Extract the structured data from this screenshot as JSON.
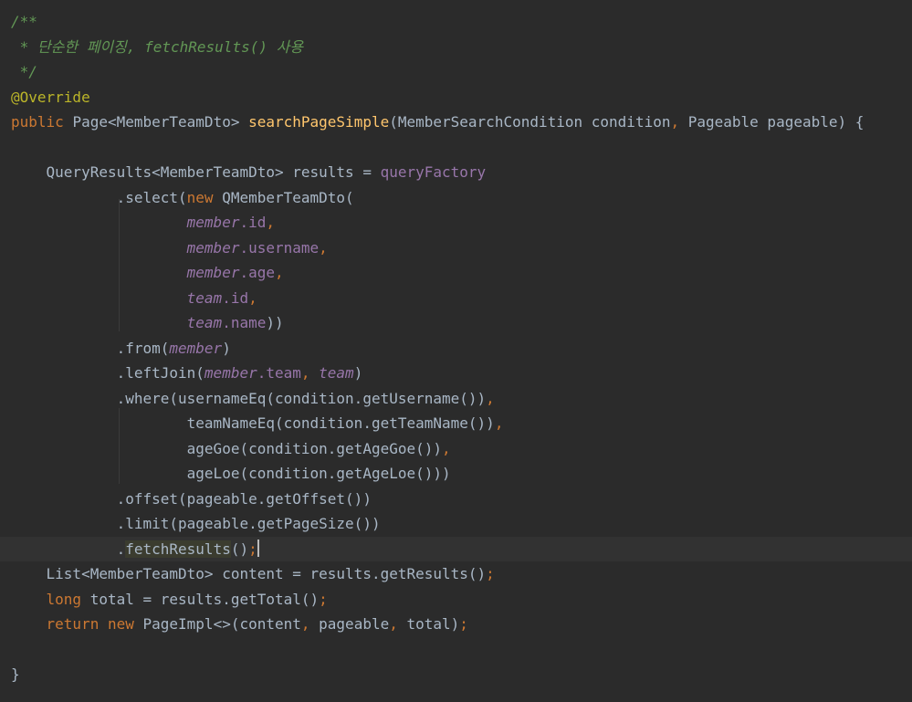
{
  "colors": {
    "background": "#2b2b2b",
    "current_line": "#323232",
    "text": "#a9b7c6",
    "keyword": "#cc7832",
    "annotation": "#bbb529",
    "method_decl": "#ffc66d",
    "field": "#9876aa",
    "doc_comment": "#629755"
  },
  "caret_line": 22,
  "lines": [
    [
      {
        "t": "/**",
        "c": "doc"
      }
    ],
    [
      {
        "t": " * 단순한 페이징, fetchResults() 사용",
        "c": "doc"
      }
    ],
    [
      {
        "t": " */",
        "c": "doc"
      }
    ],
    [
      {
        "t": "@Override",
        "c": "ann"
      }
    ],
    [
      {
        "t": "public ",
        "c": "kw"
      },
      {
        "t": "Page<MemberTeamDto> ",
        "c": "txt"
      },
      {
        "t": "searchPageSimple",
        "c": "fn"
      },
      {
        "t": "(MemberSearchCondition condition",
        "c": "txt"
      },
      {
        "t": ", ",
        "c": "kw"
      },
      {
        "t": "Pageable pageable) {",
        "c": "txt"
      }
    ],
    [],
    [
      {
        "t": "    QueryResults<MemberTeamDto> results = ",
        "c": "txt"
      },
      {
        "t": "queryFactory",
        "c": "field"
      }
    ],
    [
      {
        "t": "            .select(",
        "c": "txt"
      },
      {
        "t": "new ",
        "c": "kw"
      },
      {
        "t": "QMemberTeamDto(",
        "c": "txt"
      }
    ],
    [
      {
        "t": "                    ",
        "c": "txt"
      },
      {
        "t": "member",
        "c": "field-i"
      },
      {
        "t": ".id",
        "c": "field"
      },
      {
        "t": ",",
        "c": "kw"
      }
    ],
    [
      {
        "t": "                    ",
        "c": "txt"
      },
      {
        "t": "member",
        "c": "field-i"
      },
      {
        "t": ".username",
        "c": "field"
      },
      {
        "t": ",",
        "c": "kw"
      }
    ],
    [
      {
        "t": "                    ",
        "c": "txt"
      },
      {
        "t": "member",
        "c": "field-i"
      },
      {
        "t": ".age",
        "c": "field"
      },
      {
        "t": ",",
        "c": "kw"
      }
    ],
    [
      {
        "t": "                    ",
        "c": "txt"
      },
      {
        "t": "team",
        "c": "field-i"
      },
      {
        "t": ".id",
        "c": "field"
      },
      {
        "t": ",",
        "c": "kw"
      }
    ],
    [
      {
        "t": "                    ",
        "c": "txt"
      },
      {
        "t": "team",
        "c": "field-i"
      },
      {
        "t": ".name",
        "c": "field"
      },
      {
        "t": "))",
        "c": "txt"
      }
    ],
    [
      {
        "t": "            .from(",
        "c": "txt"
      },
      {
        "t": "member",
        "c": "field-i"
      },
      {
        "t": ")",
        "c": "txt"
      }
    ],
    [
      {
        "t": "            .leftJoin(",
        "c": "txt"
      },
      {
        "t": "member",
        "c": "field-i"
      },
      {
        "t": ".team",
        "c": "field"
      },
      {
        "t": ", ",
        "c": "kw"
      },
      {
        "t": "team",
        "c": "field-i"
      },
      {
        "t": ")",
        "c": "txt"
      }
    ],
    [
      {
        "t": "            .where(usernameEq(condition.getUsername())",
        "c": "txt"
      },
      {
        "t": ",",
        "c": "kw"
      }
    ],
    [
      {
        "t": "                    teamNameEq(condition.getTeamName())",
        "c": "txt"
      },
      {
        "t": ",",
        "c": "kw"
      }
    ],
    [
      {
        "t": "                    ageGoe(condition.getAgeGoe())",
        "c": "txt"
      },
      {
        "t": ",",
        "c": "kw"
      }
    ],
    [
      {
        "t": "                    ageLoe(condition.getAgeLoe()))",
        "c": "txt"
      }
    ],
    [
      {
        "t": "            .offset(pageable.getOffset())",
        "c": "txt"
      }
    ],
    [
      {
        "t": "            .limit(pageable.getPageSize())",
        "c": "txt"
      }
    ],
    [
      {
        "t": "            .",
        "c": "txt"
      },
      {
        "t": "fetchResults",
        "c": "txt",
        "hl": true
      },
      {
        "t": "()",
        "c": "txt"
      },
      {
        "t": ";",
        "c": "kw"
      }
    ],
    [
      {
        "t": "    List<MemberTeamDto> content = results.getResults()",
        "c": "txt"
      },
      {
        "t": ";",
        "c": "kw"
      }
    ],
    [
      {
        "t": "    ",
        "c": "txt"
      },
      {
        "t": "long ",
        "c": "kw"
      },
      {
        "t": "total = results.getTotal()",
        "c": "txt"
      },
      {
        "t": ";",
        "c": "kw"
      }
    ],
    [
      {
        "t": "    ",
        "c": "txt"
      },
      {
        "t": "return new ",
        "c": "kw"
      },
      {
        "t": "PageImpl<>(content",
        "c": "txt"
      },
      {
        "t": ", ",
        "c": "kw"
      },
      {
        "t": "pageable",
        "c": "txt"
      },
      {
        "t": ", ",
        "c": "kw"
      },
      {
        "t": "total)",
        "c": "txt"
      },
      {
        "t": ";",
        "c": "kw"
      }
    ],
    [],
    [
      {
        "t": "}",
        "c": "txt"
      }
    ]
  ]
}
